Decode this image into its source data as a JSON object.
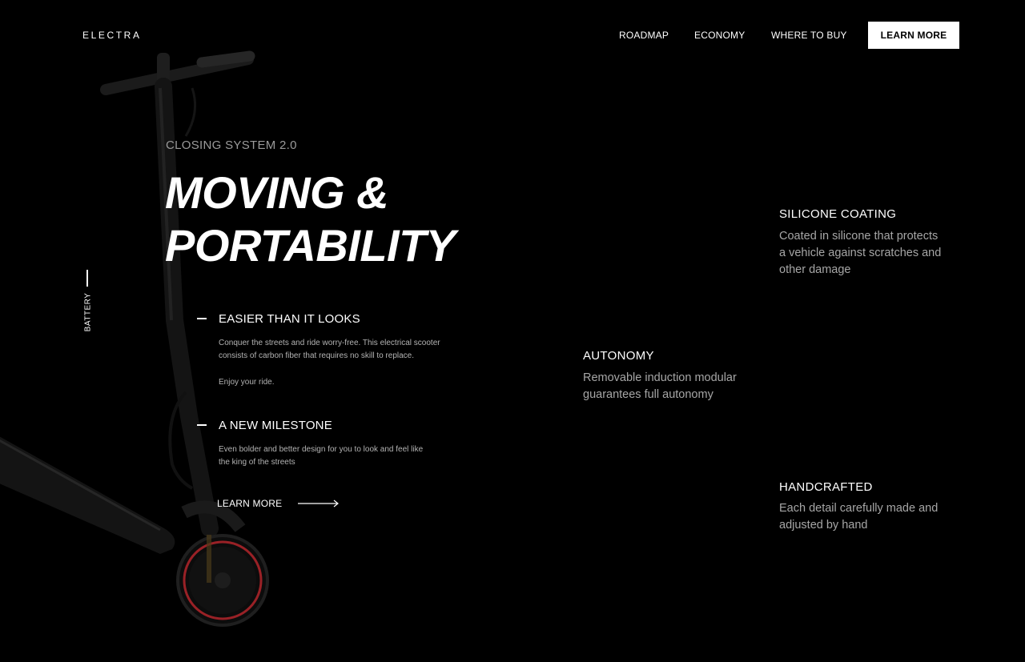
{
  "header": {
    "logo": "ELECTRA",
    "nav": [
      "ROADMAP",
      "ECONOMY",
      "WHERE TO BUY"
    ],
    "cta": "LEARN MORE"
  },
  "side": {
    "label": "BATTERY"
  },
  "hero": {
    "eyebrow": "CLOSING SYSTEM 2.0",
    "title_line1": "MOVING &",
    "title_line2": "PORTABILITY"
  },
  "features": [
    {
      "title": "EASIER THAN IT LOOKS",
      "body_line1": "Conquer the streets and ride worry-free. This electrical scooter",
      "body_line2": "consists of carbon fiber that requires no skill to replace.",
      "body_line3": "Enjoy your ride."
    },
    {
      "title": "A NEW MILESTONE",
      "body_line1": "Even bolder and better design for you to look and feel like",
      "body_line2": "the king of the streets"
    }
  ],
  "learn_more": {
    "label": "LEARN MORE",
    "icon": "arrow-right-icon"
  },
  "right_features": [
    {
      "title": "SILICONE COATING",
      "line1": "Coated in silicone that protects",
      "line2": "a vehicle against scratches and",
      "line3": "other damage"
    },
    {
      "title": "AUTONOMY",
      "line1": "Removable induction modular",
      "line2": "guarantees full autonomy"
    },
    {
      "title": "HANDCRAFTED",
      "line1": "Each detail carefully made and",
      "line2": "adjusted by hand"
    }
  ],
  "colors": {
    "background": "#000000",
    "text": "#ffffff",
    "muted": "#a6a6a6",
    "wheel_accent": "#b3262b"
  }
}
